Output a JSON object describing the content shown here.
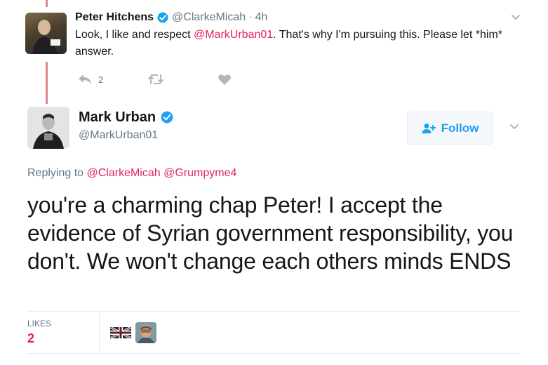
{
  "reply_tweet": {
    "name": "Peter Hitchens",
    "handle": "@ClarkeMicah",
    "time": "4h",
    "text_before": "Look, I like and respect ",
    "mention": "@MarkUrban01",
    "text_after": ". That's why I'm pursuing this. Please let *him* answer.",
    "reply_count": "2",
    "icons": {
      "reply": "reply-icon",
      "retweet": "retweet-icon",
      "like": "heart-icon",
      "verified": "verified-badge-icon",
      "more": "chevron-down-icon"
    }
  },
  "main_tweet": {
    "name": "Mark Urban",
    "handle": "@MarkUrban01",
    "follow_label": "Follow",
    "replying_prefix": "Replying to ",
    "replying_to": "@ClarkeMicah @Grumpyme4",
    "text": "you're a charming chap Peter! I accept the evidence of Syrian government responsibility, you don't. We won't change each others minds ENDS",
    "likes_label": "LIKES",
    "likes_count": "2",
    "icons": {
      "follow": "add-user-icon",
      "verified": "verified-badge-icon",
      "more": "chevron-down-icon"
    }
  },
  "colors": {
    "accent": "#1da1f2",
    "mention": "#e0245e",
    "muted": "#657786",
    "thread_line": "#e0848c"
  }
}
